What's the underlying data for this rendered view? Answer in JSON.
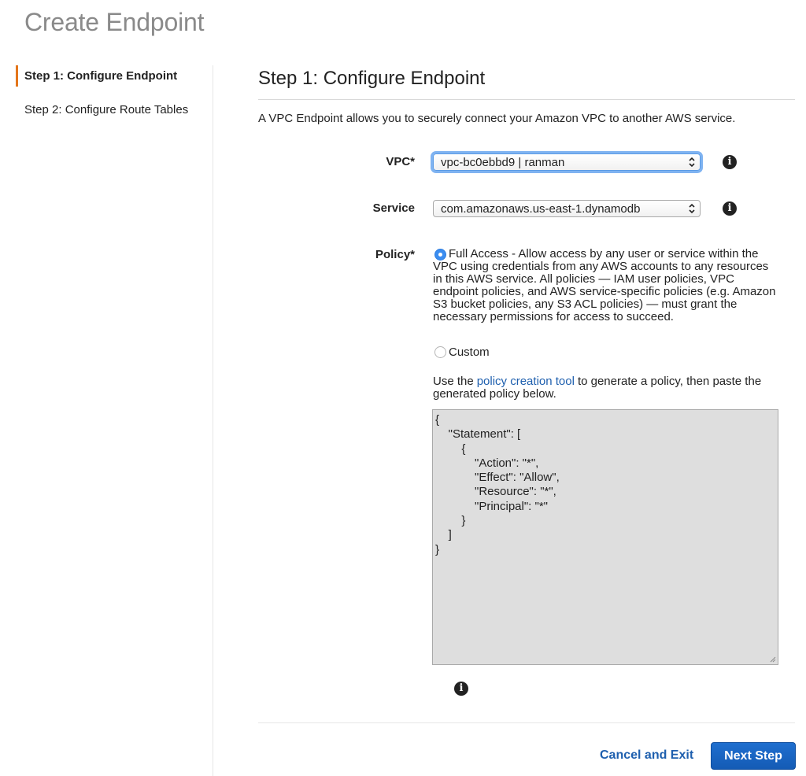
{
  "page": {
    "title": "Create Endpoint"
  },
  "sidebar": {
    "items": [
      {
        "label": "Step 1: Configure Endpoint",
        "active": true
      },
      {
        "label": "Step 2: Configure Route Tables",
        "active": false
      }
    ],
    "accent_color": "#e4761b"
  },
  "main": {
    "heading": "Step 1: Configure Endpoint",
    "intro": "A VPC Endpoint allows you to securely connect your Amazon VPC to another AWS service."
  },
  "form": {
    "vpc": {
      "label": "VPC*",
      "value": "vpc-bc0ebbd9 | ranman"
    },
    "service": {
      "label": "Service",
      "value": "com.amazonaws.us-east-1.dynamodb"
    },
    "policy": {
      "label": "Policy*",
      "full_access_text": "Full Access - Allow access by any user or service within the VPC using credentials from any AWS accounts to any resources in this AWS service. All policies — IAM user policies, VPC endpoint policies, and AWS service-specific policies (e.g. Amazon S3 bucket policies, any S3 ACL policies) — must grant the necessary permissions for access to succeed.",
      "full_access_selected": true,
      "custom_label": "Custom",
      "help_prefix": "Use the",
      "help_link": "policy creation tool",
      "help_suffix": "to generate a policy, then paste the generated policy below.",
      "document": "{\n    \"Statement\": [\n        {\n            \"Action\": \"*\",\n            \"Effect\": \"Allow\",\n            \"Resource\": \"*\",\n            \"Principal\": \"*\"\n        }\n    ]\n}"
    }
  },
  "footer": {
    "cancel_label": "Cancel and Exit",
    "next_label": "Next Step"
  },
  "icons": {
    "info": "info-icon",
    "select_arrows": "up-down-chevron-icon"
  },
  "colors": {
    "link": "#1e5fae",
    "primary_button": "#1f6fcf",
    "radio_selected": "#3b8df0",
    "title_gray": "#8a8a8a"
  }
}
